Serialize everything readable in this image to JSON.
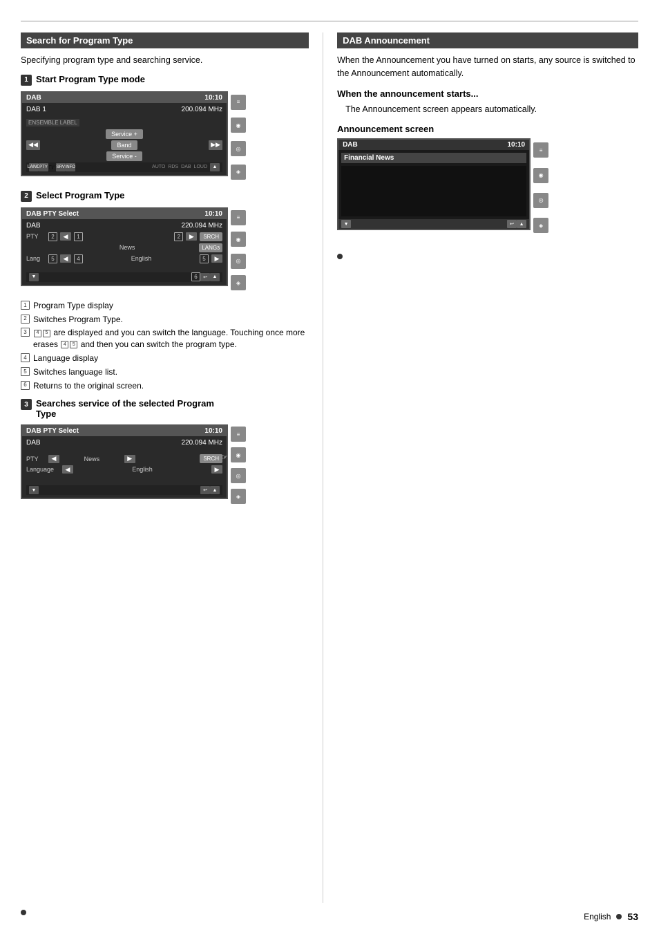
{
  "page": {
    "top_divider": true
  },
  "left_section": {
    "header": "Search for Program Type",
    "description": "Specifying program type and searching service.",
    "step1": {
      "badge": "1",
      "title": "Start Program Type mode",
      "screen": {
        "header_left": "DAB",
        "header_right": "10:10",
        "sub_left": "DAB 1",
        "sub_right": "200.094 MHz",
        "ensemble_label": "ENSEMBLE LABEL",
        "buttons": {
          "service_plus": "Service +",
          "band": "Band",
          "service_minus": "Service -"
        },
        "bottom_labels": [
          "LANG",
          "PTY",
          "SRV",
          "INFO",
          "AUTO",
          "RDS",
          "DAB",
          "LOUD"
        ]
      }
    },
    "step2": {
      "badge": "2",
      "title": "Select Program Type",
      "screen": {
        "header_left": "DAB PTY Select",
        "header_right": "10:10",
        "sub_left": "DAB",
        "sub_right": "220.094 MHz",
        "pty_label": "PTY",
        "pty_num": "2",
        "badge1": "1",
        "badge2": "2",
        "srch_btn": "SRCH",
        "news_label": "News",
        "lang_label": "Lang",
        "badge3": "3",
        "lang_btn": "LANG",
        "badge4": "4",
        "badge5": "5",
        "english_label": "English",
        "badge6": "6"
      },
      "notes": [
        {
          "badge": "1",
          "text": "Program Type display"
        },
        {
          "badge": "2",
          "text": "Switches Program Type."
        },
        {
          "badge": "3_4_5",
          "text": "are displayed and you can switch the language. Touching once more erases",
          "badges_inline": [
            "4",
            "5"
          ],
          "text2": "and then you can switch the program type."
        },
        {
          "badge": "4",
          "text": "Language display"
        },
        {
          "badge": "5",
          "text": "Switches language list."
        },
        {
          "badge": "6",
          "text": "Returns to the original screen."
        }
      ]
    },
    "step3": {
      "badge": "3",
      "title": "Searches service of the selected Program Type",
      "screen": {
        "header_left": "DAB PTY Select",
        "header_right": "10:10",
        "sub_left": "DAB",
        "sub_right": "220.094 MHz",
        "pty_label": "PTY",
        "news_label": "News",
        "lang_label": "Language",
        "english_label": "English",
        "srch_btn": "SRCH"
      }
    }
  },
  "right_section": {
    "header": "DAB Announcement",
    "description": "When the Announcement you have turned on starts, any source is switched to the Announcement automatically.",
    "when_starts_header": "When the announcement starts...",
    "when_starts_text": "The Announcement screen appears automatically.",
    "announcement_screen_header": "Announcement screen",
    "screen": {
      "header_left": "DAB",
      "header_right": "10:10",
      "content_label": "Financial News"
    }
  },
  "footer": {
    "language": "English",
    "page": "53"
  }
}
